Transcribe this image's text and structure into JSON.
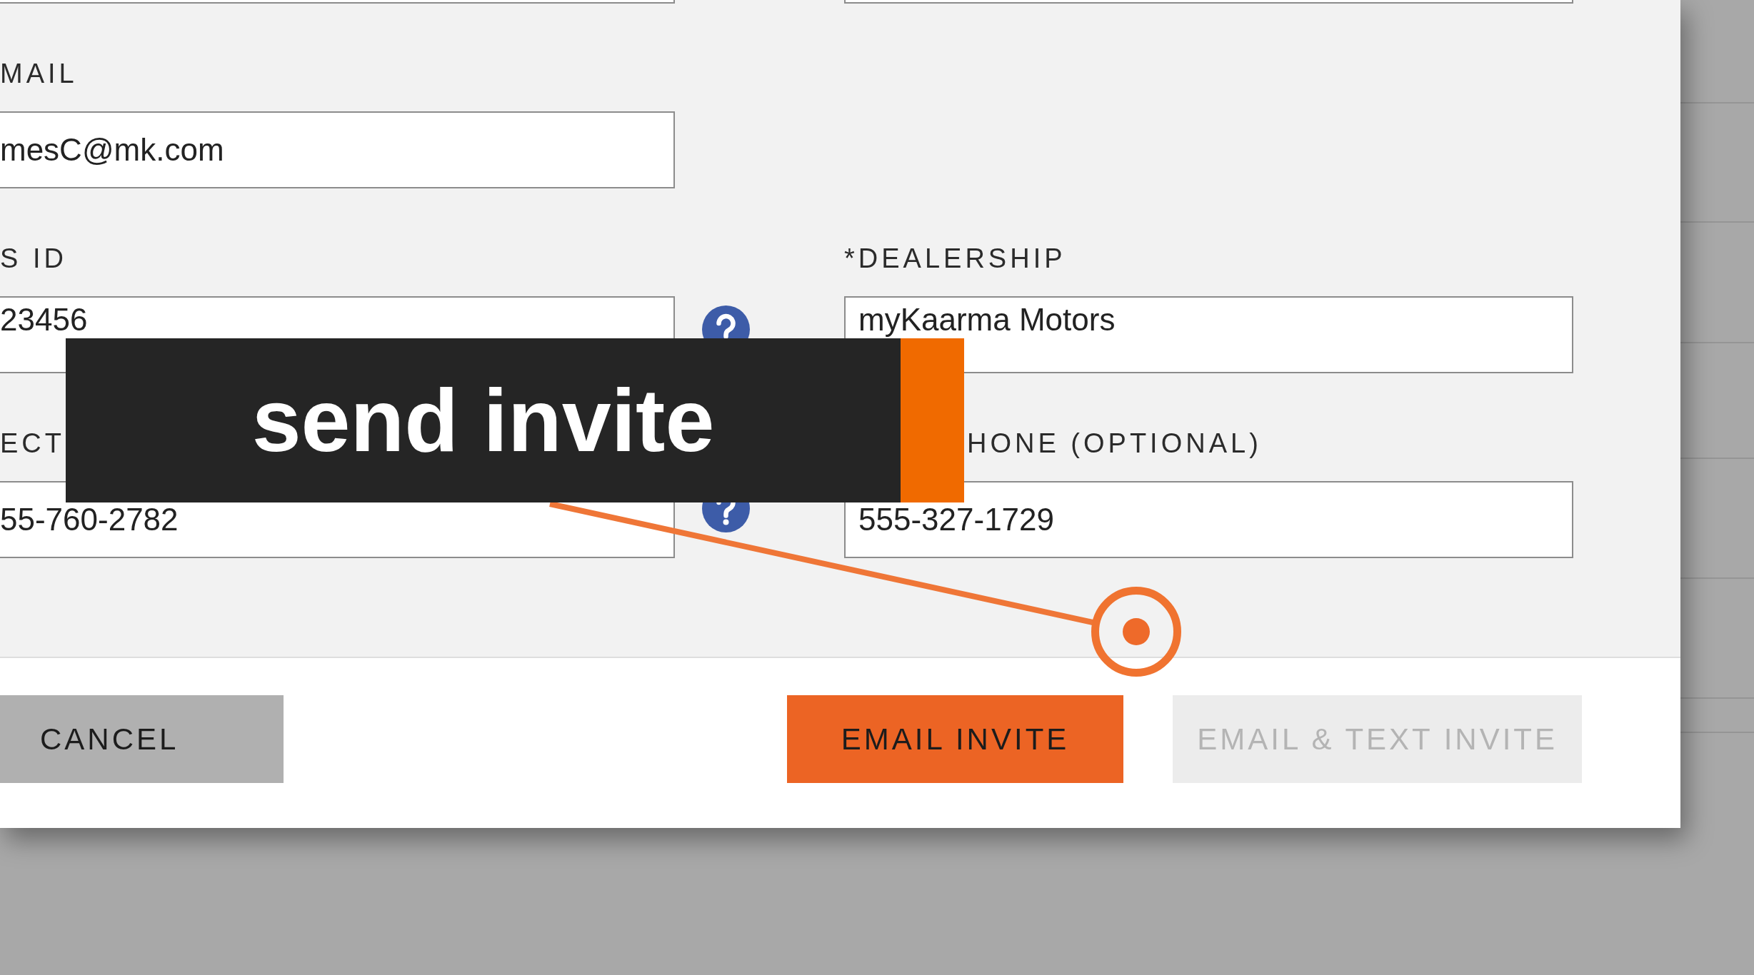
{
  "dialog": {
    "form_rows": [
      {
        "left": {
          "label": "MAIL",
          "value": "mesC@mk.com"
        }
      },
      {
        "left": {
          "label": "S ID",
          "value": "23456",
          "help": true
        },
        "right": {
          "label": "*DEALERSHIP",
          "value": "myKaarma Motors"
        }
      },
      {
        "left": {
          "label": "ECT",
          "value": "55-760-2782",
          "help": true
        },
        "right": {
          "label": "HONE (OPTIONAL)",
          "value": "555-327-1729"
        }
      }
    ],
    "buttons": [
      {
        "label": "CANCEL",
        "kind": "secondary",
        "disabled": false
      },
      {
        "label": "EMAIL INVITE",
        "kind": "primary",
        "disabled": false
      },
      {
        "label": "EMAIL & TEXT INVITE",
        "kind": "primary",
        "disabled": true
      }
    ]
  },
  "caption": {
    "text": "send invite"
  }
}
